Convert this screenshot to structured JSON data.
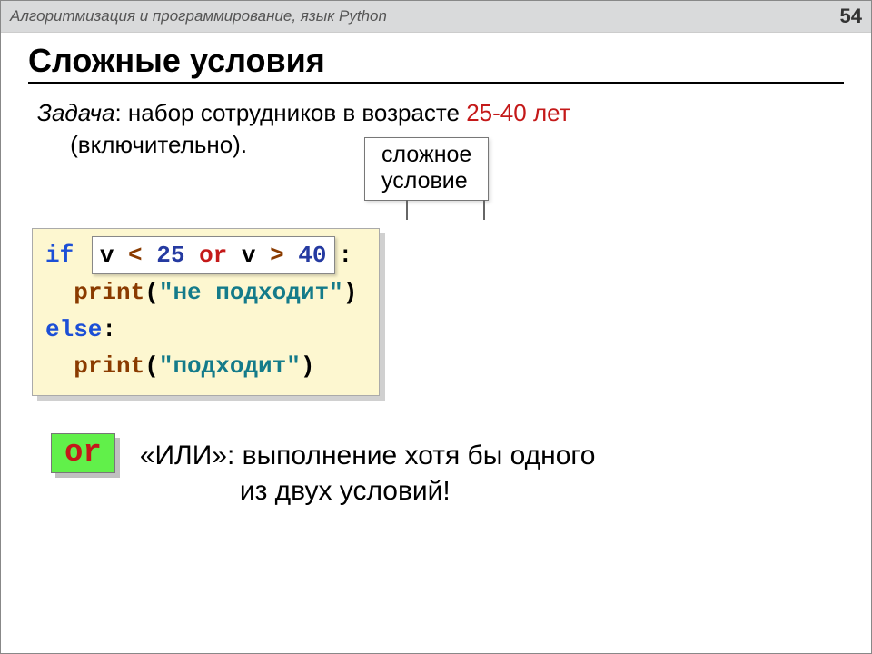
{
  "topbar": {
    "title": "Алгоритмизация и программирование, язык Python",
    "page": "54"
  },
  "heading": "Сложные условия",
  "task": {
    "label": "Задача",
    "colon": ": ",
    "before_range": "набор сотрудников в возрасте ",
    "range": "25-40 лет",
    "after_range": " (включительно).",
    "indent_prefix": ""
  },
  "callout": {
    "line1": "сложное",
    "line2": "условие"
  },
  "code": {
    "kw_if": "if ",
    "cond_v1": "v ",
    "cond_lt": "<",
    "cond_25": " 25 ",
    "cond_or": "or",
    "cond_v2": " v ",
    "cond_gt": ">",
    "cond_40": " 40",
    "colon": ":",
    "print1_kw": "print",
    "print1_open": "(",
    "print1_str": "\"не подходит\"",
    "print1_close": ")",
    "kw_else": "else",
    "else_colon": ":",
    "print2_kw": "print",
    "print2_open": "(",
    "print2_str": "\"подходит\"",
    "print2_close": ")"
  },
  "or": {
    "chip": "or",
    "line1": "«ИЛИ»: выполнение хотя бы одного",
    "line2": "из двух условий!"
  }
}
